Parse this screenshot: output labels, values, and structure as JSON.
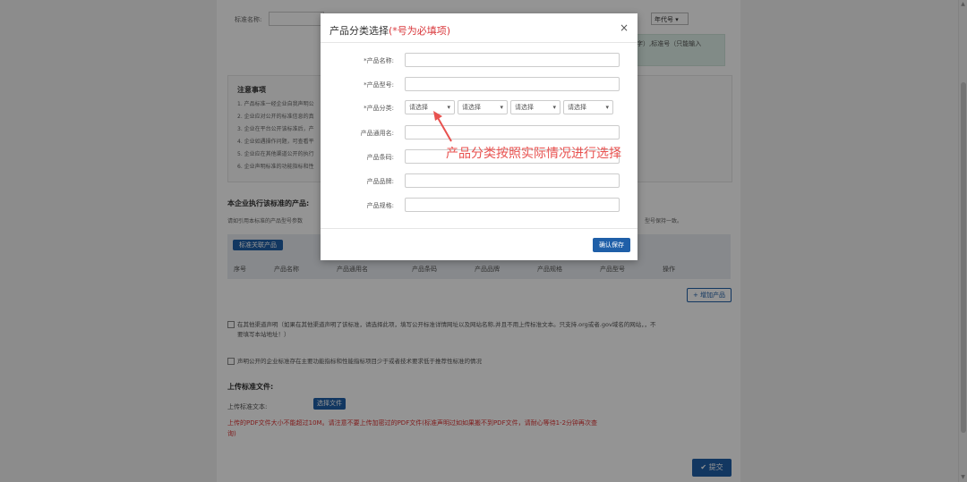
{
  "background": {
    "top_label": "标准名称:",
    "top_select": "年代号",
    "green_note": "字）,标准号（只能输入",
    "notice_title": "注意事项",
    "notice_lines": [
      "1. 产品标准一经企业自我声明公",
      "2. 企业应对公开的标准信息的真",
      "3. 企业在平台公开该标准后，产",
      "4. 企业如遇操作问题，可查看平",
      "5. 企业应在其他渠道公开的执行",
      "6. 企业声明标准的功能指标和性"
    ],
    "section_products": "本企业执行该标准的产品:",
    "products_desc": "请如引用本标准的产品型号参数",
    "products_desc_tail": "型号保持一致。",
    "related_tag": "标准关联产品",
    "table_headers": [
      "序号",
      "产品名称",
      "产品通用名",
      "产品条码",
      "产品品牌",
      "产品规格",
      "产品型号",
      "操作"
    ],
    "add_product": "+ 增加产品",
    "check1": "在其他渠道声明（如果在其他渠道声明了该标准，请选择此项，填写公开标准详情网址以及网站名称,并且不用上传标准文本。只支持.org或者.gov域名的网站，，不",
    "check1_line2": "要填写本站地址！）",
    "check2": "声明公开的企业标准存在主要功能指标和性能指标项目少于或者技术要求低于推荐性标准的情况",
    "upload_section": "上传标准文件:",
    "upload_label": "上传标准文本:",
    "choose_file": "选择文件",
    "upload_warning": "上传的PDF文件大小不能超过10M。请注意不要上传加密过的PDF文件(标准声明过如如果搬不到PDF文件，请耐心等待1-2分钟再次查",
    "upload_warning2": "询)",
    "submit": "✔ 提交"
  },
  "modal": {
    "title": "产品分类选择",
    "title_required": "(*号为必填项)",
    "close": "×",
    "fields": [
      {
        "label": "*产品名称:"
      },
      {
        "label": "*产品型号:"
      },
      {
        "label": "*产品分类:"
      },
      {
        "label": "产品通用名:"
      },
      {
        "label": "产品条码:"
      },
      {
        "label": "产品品牌:"
      },
      {
        "label": "产品规格:"
      }
    ],
    "category_selects": [
      "请选择",
      "请选择",
      "请选择",
      "请选择"
    ],
    "save_button": "确认保存"
  },
  "annotation": "产品分类按照实际情况进行选择",
  "colors": {
    "accent": "#1f5fa8",
    "required": "#d9373b",
    "annotation": "#e8514f"
  }
}
